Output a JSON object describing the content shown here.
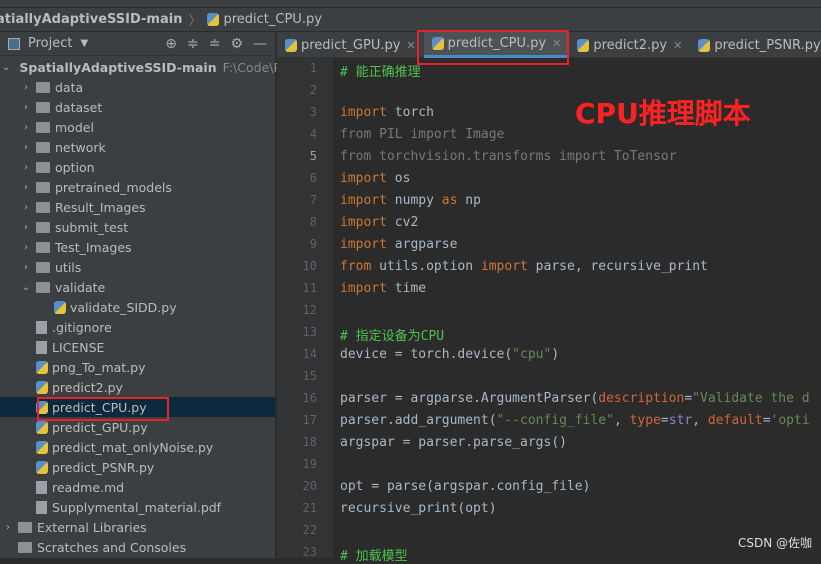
{
  "breadcrumb": {
    "project": "atiallyAdaptiveSSID-main",
    "file": "predict_CPU.py"
  },
  "sidebar": {
    "title": "Project",
    "root": {
      "name": "SpatiallyAdaptiveSSID-main",
      "path": "F:\\Code\\Py"
    },
    "items": [
      {
        "label": "data",
        "type": "folder",
        "depth": 1,
        "arrow": "›"
      },
      {
        "label": "dataset",
        "type": "folder",
        "depth": 1,
        "arrow": "›"
      },
      {
        "label": "model",
        "type": "folder",
        "depth": 1,
        "arrow": "›"
      },
      {
        "label": "network",
        "type": "folder",
        "depth": 1,
        "arrow": "›"
      },
      {
        "label": "option",
        "type": "folder",
        "depth": 1,
        "arrow": "›"
      },
      {
        "label": "pretrained_models",
        "type": "folder",
        "depth": 1,
        "arrow": "›"
      },
      {
        "label": "Result_Images",
        "type": "folder",
        "depth": 1,
        "arrow": "›"
      },
      {
        "label": "submit_test",
        "type": "folder",
        "depth": 1,
        "arrow": "›"
      },
      {
        "label": "Test_Images",
        "type": "folder",
        "depth": 1,
        "arrow": "›"
      },
      {
        "label": "utils",
        "type": "folder",
        "depth": 1,
        "arrow": "›"
      },
      {
        "label": "validate",
        "type": "folder",
        "depth": 1,
        "arrow": "⌄"
      },
      {
        "label": "validate_SIDD.py",
        "type": "py",
        "depth": 2
      },
      {
        "label": ".gitignore",
        "type": "file",
        "depth": 1
      },
      {
        "label": "LICENSE",
        "type": "file",
        "depth": 1
      },
      {
        "label": "png_To_mat.py",
        "type": "py",
        "depth": 1
      },
      {
        "label": "predict2.py",
        "type": "py",
        "depth": 1
      },
      {
        "label": "predict_CPU.py",
        "type": "py",
        "depth": 1,
        "selected": true
      },
      {
        "label": "predict_GPU.py",
        "type": "py",
        "depth": 1
      },
      {
        "label": "predict_mat_onlyNoise.py",
        "type": "py",
        "depth": 1
      },
      {
        "label": "predict_PSNR.py",
        "type": "py",
        "depth": 1
      },
      {
        "label": "readme.md",
        "type": "file",
        "depth": 1
      },
      {
        "label": "Supplymental_material.pdf",
        "type": "file",
        "depth": 1
      },
      {
        "label": "External Libraries",
        "type": "lib",
        "depth": 0,
        "arrow": "›"
      },
      {
        "label": "Scratches and Consoles",
        "type": "lib",
        "depth": 0
      }
    ]
  },
  "tabs": [
    {
      "label": "predict_GPU.py"
    },
    {
      "label": "predict_CPU.py",
      "active": true
    },
    {
      "label": "predict2.py"
    },
    {
      "label": "predict_PSNR.py"
    }
  ],
  "annotation": "CPU推理脚本",
  "watermark": "CSDN @佐咖",
  "current_line": 5,
  "code": [
    [
      [
        "# 能正确推理",
        "cm"
      ]
    ],
    [],
    [
      [
        "import",
        "kw"
      ],
      [
        " torch",
        ""
      ]
    ],
    [
      [
        "from PIL import Image",
        "dim"
      ]
    ],
    [
      [
        "from torchvision.transforms import ToTensor",
        "dim"
      ]
    ],
    [
      [
        "import",
        "kw"
      ],
      [
        " os",
        ""
      ]
    ],
    [
      [
        "import",
        "kw"
      ],
      [
        " numpy ",
        ""
      ],
      [
        "as",
        "kw"
      ],
      [
        " np",
        ""
      ]
    ],
    [
      [
        "import",
        "kw"
      ],
      [
        " cv2",
        ""
      ]
    ],
    [
      [
        "import",
        "kw"
      ],
      [
        " argparse",
        ""
      ]
    ],
    [
      [
        "from",
        "kw"
      ],
      [
        " utils.option ",
        ""
      ],
      [
        "import",
        "kw"
      ],
      [
        " parse, recursive_print",
        ""
      ]
    ],
    [
      [
        "import",
        "kw"
      ],
      [
        " time",
        ""
      ]
    ],
    [],
    [
      [
        "# 指定设备为CPU",
        "cm"
      ]
    ],
    [
      [
        "device = torch.device(",
        ""
      ],
      [
        "\"cpu\"",
        "st"
      ],
      [
        ")",
        ""
      ]
    ],
    [],
    [
      [
        "parser = argparse.ArgumentParser(",
        ""
      ],
      [
        "description",
        "pm"
      ],
      [
        "=",
        ""
      ],
      [
        "\"Validate the d",
        "st"
      ]
    ],
    [
      [
        "parser.add_argument(",
        ""
      ],
      [
        "\"--config_file\"",
        "st"
      ],
      [
        ", ",
        ""
      ],
      [
        "type",
        "pm"
      ],
      [
        "=",
        ""
      ],
      [
        "str",
        "bi"
      ],
      [
        ", ",
        ""
      ],
      [
        "default",
        "pm"
      ],
      [
        "=",
        ""
      ],
      [
        "'opti",
        "st"
      ]
    ],
    [
      [
        "argspar = parser.parse_args()",
        ""
      ]
    ],
    [],
    [
      [
        "opt = parse(argspar.config_file)",
        ""
      ]
    ],
    [
      [
        "recursive_print(opt)",
        ""
      ]
    ],
    [],
    [
      [
        "# 加载模型",
        "cm"
      ]
    ]
  ]
}
